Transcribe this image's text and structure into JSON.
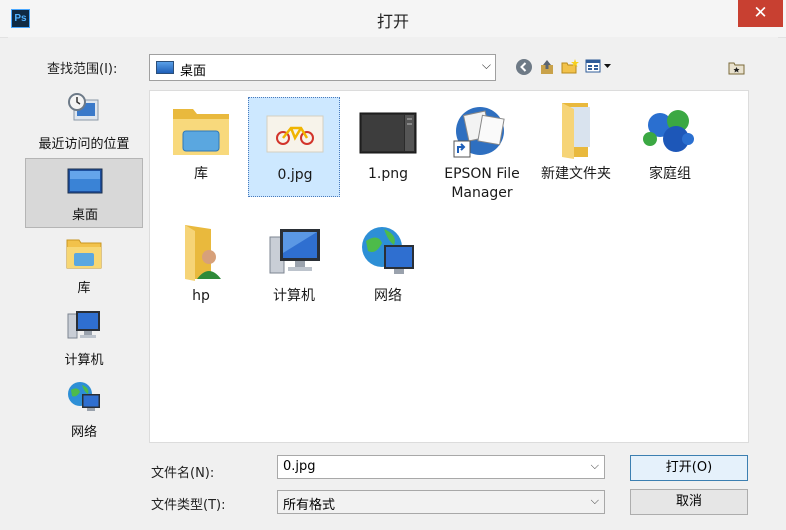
{
  "window": {
    "title": "打开",
    "app_badge": "Ps",
    "close_glyph": "✕"
  },
  "lookin": {
    "label": "查找范围(I):",
    "value": "桌面"
  },
  "toolbar": {
    "back_icon": "back-icon",
    "up_icon": "up-folder-icon",
    "new_folder_icon": "new-folder-icon",
    "view_icon": "view-menu-icon",
    "extra_icon": "folder-star-icon"
  },
  "places": [
    {
      "label": "最近访问的位置",
      "icon": "recent-places-icon"
    },
    {
      "label": "桌面",
      "icon": "desktop-icon",
      "selected": true
    },
    {
      "label": "库",
      "icon": "library-icon"
    },
    {
      "label": "计算机",
      "icon": "computer-icon"
    },
    {
      "label": "网络",
      "icon": "network-icon"
    }
  ],
  "files": [
    {
      "label": "库",
      "icon": "library-folder-icon"
    },
    {
      "label": "0.jpg",
      "icon": "image-thumbnail-icon",
      "selected": true
    },
    {
      "label": "1.png",
      "icon": "image-thumbnail-icon"
    },
    {
      "label": "EPSON File Manager",
      "icon": "epson-shortcut-icon"
    },
    {
      "label": "新建文件夹",
      "icon": "folder-icon"
    },
    {
      "label": "家庭组",
      "icon": "homegroup-icon"
    },
    {
      "label": "hp",
      "icon": "user-folder-icon"
    },
    {
      "label": "计算机",
      "icon": "computer-icon"
    },
    {
      "label": "网络",
      "icon": "network-icon"
    }
  ],
  "filename": {
    "label": "文件名(N):",
    "value": "0.jpg"
  },
  "filetype": {
    "label": "文件类型(T):",
    "value": "所有格式"
  },
  "buttons": {
    "open": "打开(O)",
    "cancel": "取消"
  },
  "colors": {
    "close": "#c84031",
    "selection": "#cde8ff",
    "place_selected": "#d8d8d8"
  }
}
